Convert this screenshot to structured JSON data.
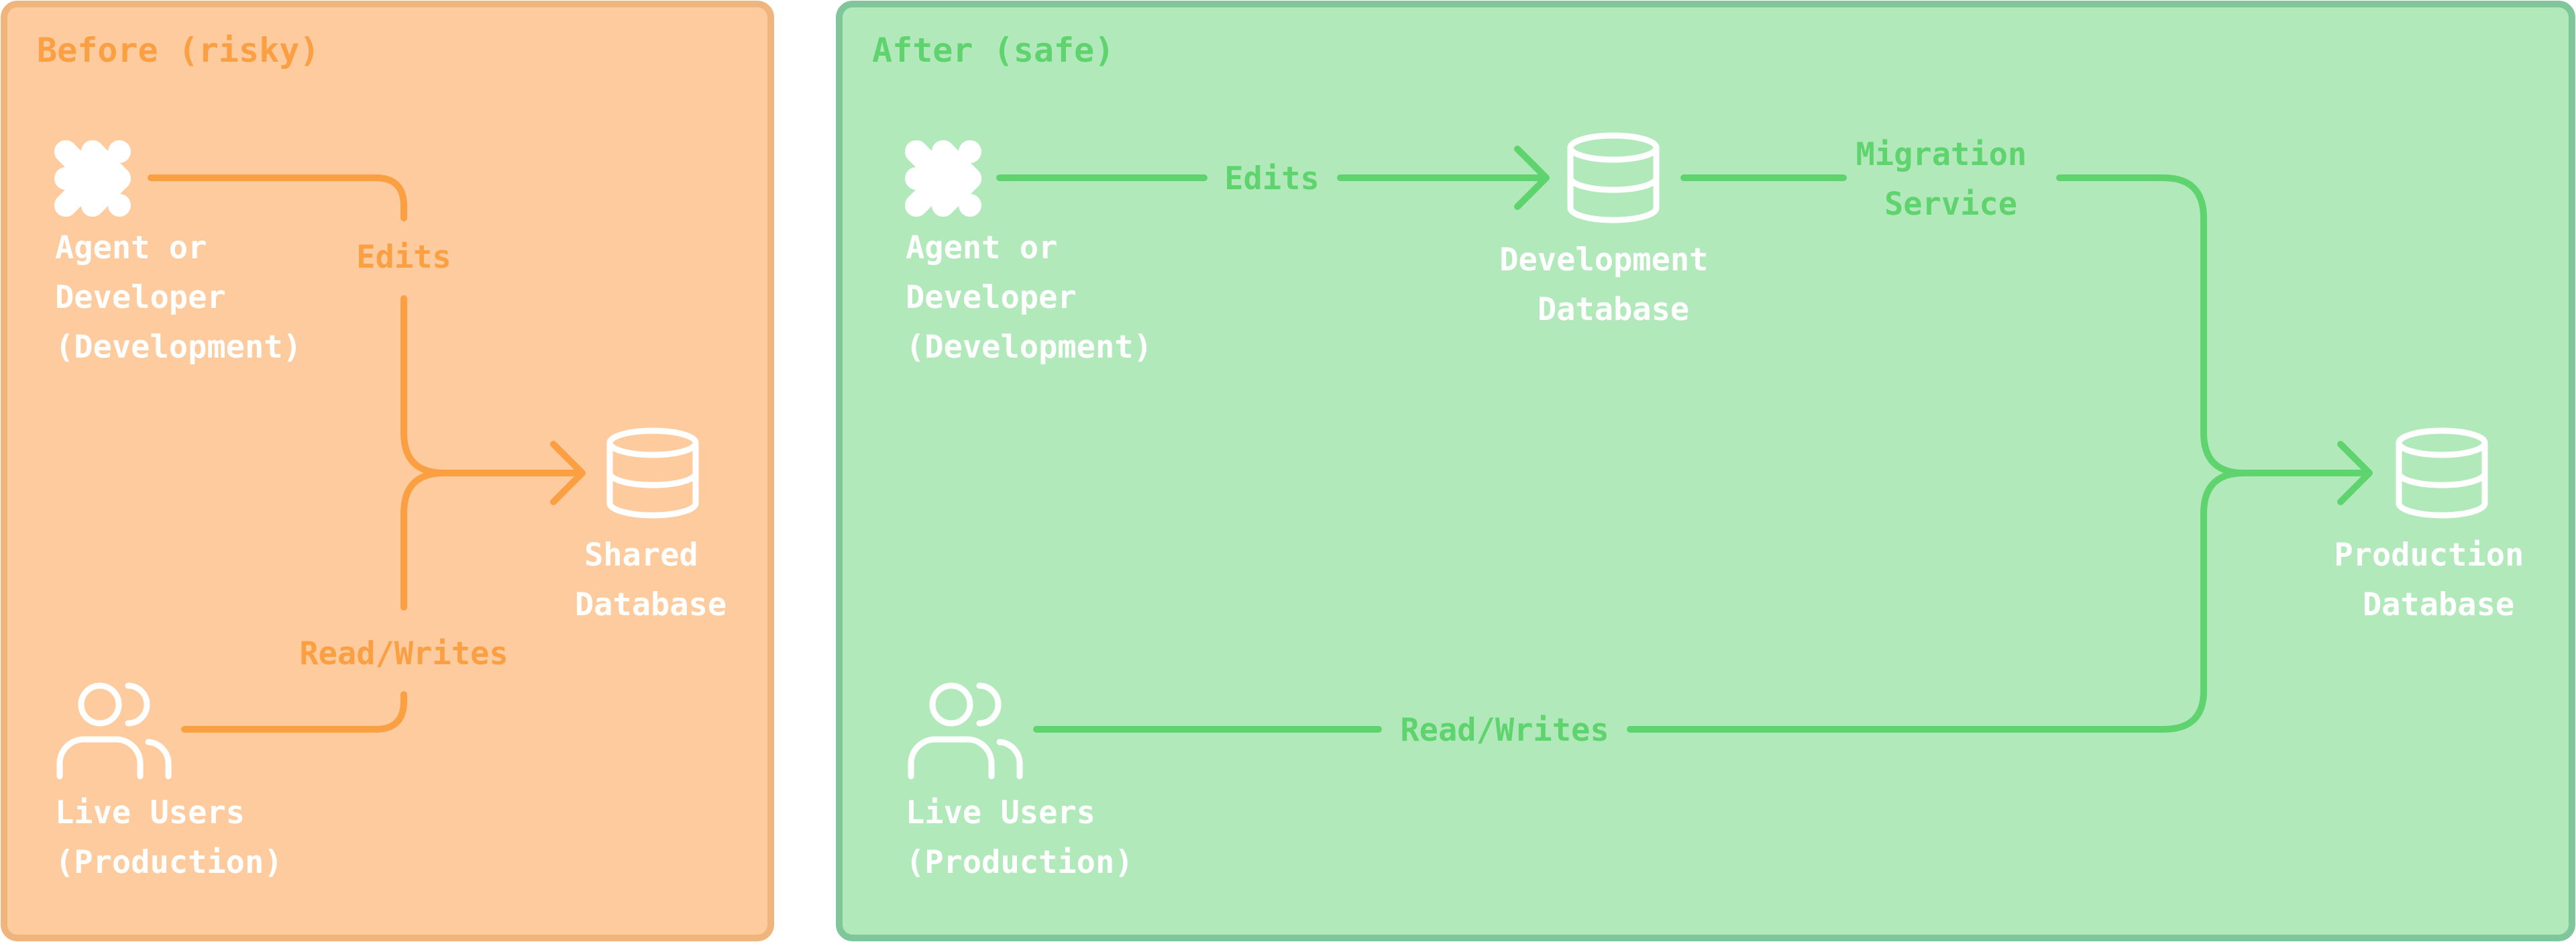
{
  "before": {
    "title": "Before (risky)",
    "agent_label": [
      "Agent or",
      "Developer",
      "(Development)"
    ],
    "users_label": [
      "Live Users",
      "(Production)"
    ],
    "edits_label": "Edits",
    "readwrites_label": "Read/Writes",
    "db_label": [
      "Shared",
      "Database"
    ]
  },
  "after": {
    "title": "After (safe)",
    "agent_label": [
      "Agent or",
      "Developer",
      "(Development)"
    ],
    "users_label": [
      "Live Users",
      "(Production)"
    ],
    "edits_label": "Edits",
    "dev_db_label": [
      "Development",
      "Database"
    ],
    "migration_label": [
      "Migration",
      "Service"
    ],
    "readwrites_label": "Read/Writes",
    "prod_db_label": [
      "Production",
      "Database"
    ]
  },
  "colors": {
    "before_fill": "#fecb9f",
    "before_border": "#f0b57c",
    "before_accent": "#fb9f43",
    "after_fill": "#b2e9bb",
    "after_border": "#7fc69b",
    "after_accent": "#5fd36d",
    "icon": "#ffffff"
  },
  "icons": {
    "agent": "agent-logo-icon",
    "users": "users-icon",
    "database": "database-icon"
  }
}
